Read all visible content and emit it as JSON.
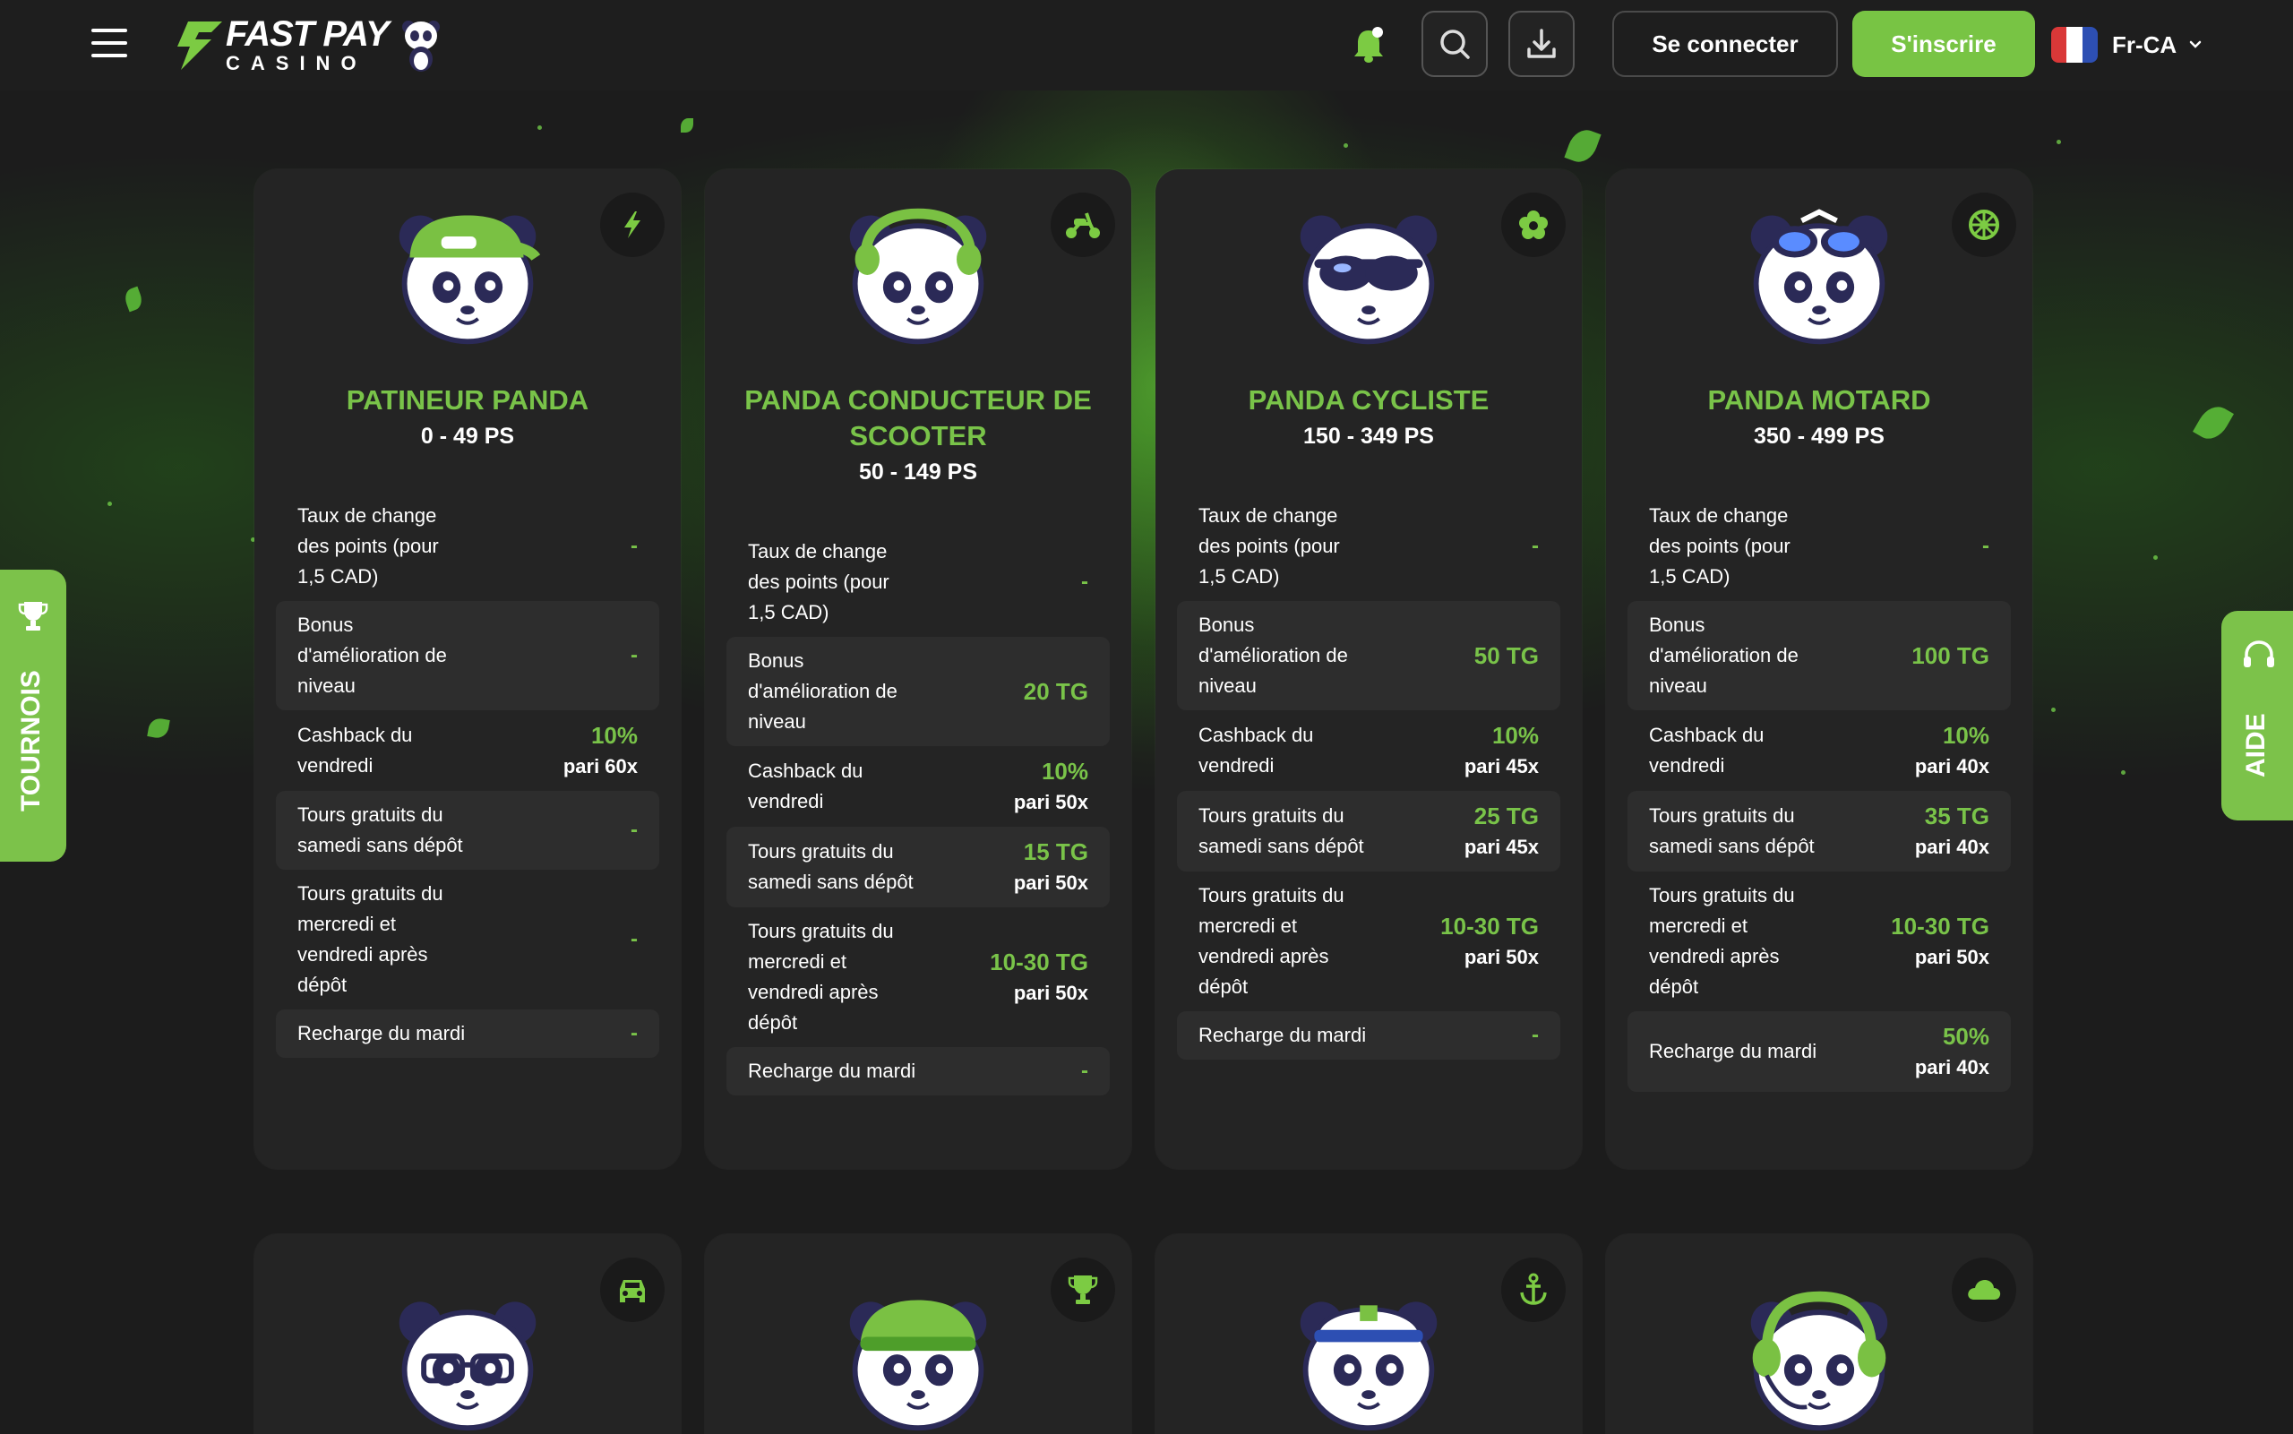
{
  "header": {
    "logo_top": "FAST PAY",
    "logo_bottom": "CASINO",
    "login_label": "Se connecter",
    "signup_label": "S'inscrire",
    "language": "Fr-CA"
  },
  "side": {
    "left_label": "TOURNOIS",
    "right_label": "AIDE"
  },
  "accent": "#79c349",
  "cards": [
    {
      "title": "PATINEUR PANDA",
      "range": "0 - 49 PS",
      "icon": "lightning-icon",
      "rows": [
        {
          "label": "Taux de change des points (pour 1,5 CAD)",
          "value": "-",
          "sub": ""
        },
        {
          "label": "Bonus d'amélioration de niveau",
          "value": "-",
          "sub": ""
        },
        {
          "label": "Cashback du vendredi",
          "value": "10%",
          "sub": "pari 60x"
        },
        {
          "label": "Tours gratuits du samedi sans dépôt",
          "value": "-",
          "sub": ""
        },
        {
          "label": "Tours gratuits du mercredi et vendredi après dépôt",
          "value": "-",
          "sub": ""
        },
        {
          "label": "Recharge du mardi",
          "value": "-",
          "sub": ""
        }
      ]
    },
    {
      "title": "PANDA CONDUCTEUR DE SCOOTER",
      "range": "50 - 149 PS",
      "icon": "scooter-icon",
      "rows": [
        {
          "label": "Taux de change des points (pour 1,5 CAD)",
          "value": "-",
          "sub": ""
        },
        {
          "label": "Bonus d'amélioration de niveau",
          "value": "20 TG",
          "sub": ""
        },
        {
          "label": "Cashback du vendredi",
          "value": "10%",
          "sub": "pari 50x"
        },
        {
          "label": "Tours gratuits du samedi sans dépôt",
          "value": "15 TG",
          "sub": "pari 50x"
        },
        {
          "label": "Tours gratuits du mercredi et vendredi après dépôt",
          "value": "10-30 TG",
          "sub": "pari 50x"
        },
        {
          "label": "Recharge du mardi",
          "value": "-",
          "sub": ""
        }
      ]
    },
    {
      "title": "PANDA CYCLISTE",
      "range": "150 - 349 PS",
      "icon": "flower-icon",
      "rows": [
        {
          "label": "Taux de change des points (pour 1,5 CAD)",
          "value": "-",
          "sub": ""
        },
        {
          "label": "Bonus d'amélioration de niveau",
          "value": "50 TG",
          "sub": ""
        },
        {
          "label": "Cashback du vendredi",
          "value": "10%",
          "sub": "pari 45x"
        },
        {
          "label": "Tours gratuits du samedi sans dépôt",
          "value": "25 TG",
          "sub": "pari 45x"
        },
        {
          "label": "Tours gratuits du mercredi et vendredi après dépôt",
          "value": "10-30 TG",
          "sub": "pari 50x"
        },
        {
          "label": "Recharge du mardi",
          "value": "-",
          "sub": ""
        }
      ]
    },
    {
      "title": "PANDA MOTARD",
      "range": "350 - 499 PS",
      "icon": "wheel-icon",
      "rows": [
        {
          "label": "Taux de change des points (pour 1,5 CAD)",
          "value": "-",
          "sub": ""
        },
        {
          "label": "Bonus d'amélioration de niveau",
          "value": "100 TG",
          "sub": ""
        },
        {
          "label": "Cashback du vendredi",
          "value": "10%",
          "sub": "pari 40x"
        },
        {
          "label": "Tours gratuits du samedi sans dépôt",
          "value": "35 TG",
          "sub": "pari 40x"
        },
        {
          "label": "Tours gratuits du mercredi et vendredi après dépôt",
          "value": "10-30 TG",
          "sub": "pari 50x"
        },
        {
          "label": "Recharge du mardi",
          "value": "50%",
          "sub": "pari 40x"
        }
      ]
    }
  ],
  "lower_cards": [
    {
      "icon": "car-icon",
      "avatar": "panda-glasses-avatar"
    },
    {
      "icon": "trophy-icon",
      "avatar": "panda-beanie-avatar"
    },
    {
      "icon": "anchor-icon",
      "avatar": "panda-captain-avatar"
    },
    {
      "icon": "cloud-icon",
      "avatar": "panda-headphones-avatar"
    }
  ]
}
